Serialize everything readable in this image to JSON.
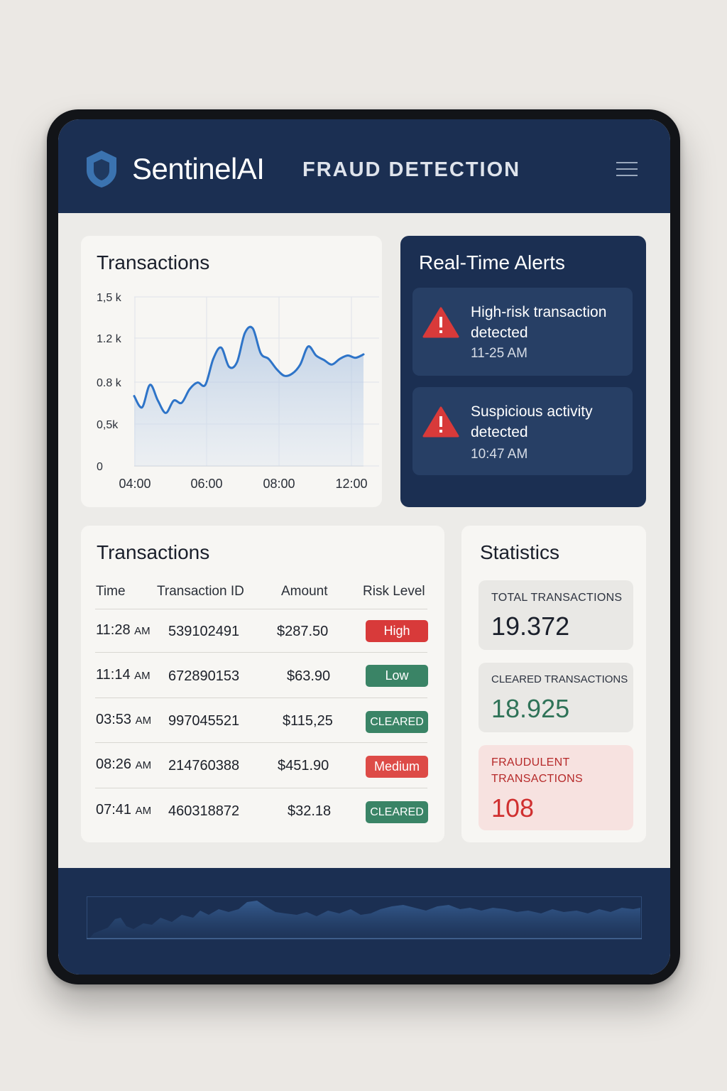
{
  "header": {
    "brand": "SentinelAI",
    "subtitle": "FRAUD DETECTION"
  },
  "chart_card": {
    "title": "Transactions"
  },
  "chart_data": {
    "type": "area",
    "title": "Transactions",
    "x_ticks": [
      "04:00",
      "06:00",
      "08:00",
      "12:00"
    ],
    "y_ticks": [
      "0",
      "0,5k",
      "0.8 k",
      "1.2 k",
      "1,5 k"
    ],
    "x": [
      "04:00",
      "04:15",
      "04:30",
      "04:45",
      "05:00",
      "05:15",
      "05:30",
      "05:45",
      "06:00",
      "06:15",
      "06:30",
      "06:45",
      "07:00",
      "07:15",
      "07:30",
      "07:45",
      "08:00",
      "08:15",
      "08:30",
      "08:45",
      "09:00",
      "09:15",
      "09:30",
      "09:45",
      "10:00",
      "10:15",
      "10:30",
      "11:00",
      "11:30",
      "12:00"
    ],
    "values": [
      0.62,
      0.52,
      0.72,
      0.58,
      0.47,
      0.58,
      0.56,
      0.68,
      0.74,
      0.72,
      0.95,
      1.05,
      0.88,
      0.92,
      1.18,
      1.22,
      1.0,
      0.95,
      0.86,
      0.8,
      0.82,
      0.9,
      1.06,
      0.98,
      0.94,
      0.9,
      0.95,
      0.98,
      0.96,
      0.99
    ],
    "ylim": [
      0,
      1.5
    ],
    "color": "#2e74c8"
  },
  "alerts": {
    "title": "Real-Time Alerts",
    "items": [
      {
        "text": "High-risk transaction detected",
        "time": "11-25 AM"
      },
      {
        "text": "Suspicious activity detected",
        "time": "10:47 AM"
      }
    ]
  },
  "transactions": {
    "title": "Transactions",
    "columns": [
      "Time",
      "Transaction ID",
      "Amount",
      "Risk Level"
    ],
    "rows": [
      {
        "time": "11:28",
        "ampm": "AM",
        "id": "539102491",
        "amount": "$287.50",
        "risk": "High",
        "color": "#d83a3a"
      },
      {
        "time": "11:14",
        "ampm": "AM",
        "id": "672890153",
        "amount": "$63.90",
        "risk": "Low",
        "color": "#3a8466"
      },
      {
        "time": "03:53",
        "ampm": "AM",
        "id": "997045521",
        "amount": "$115,25",
        "risk": "CLEARED",
        "color": "#3a8466"
      },
      {
        "time": "08:26",
        "ampm": "AM",
        "id": "214760388",
        "amount": "$451.90",
        "risk": "Medium",
        "color": "#dd4b47"
      },
      {
        "time": "07:41",
        "ampm": "AM",
        "id": "460318872",
        "amount": "$32.18",
        "risk": "CLEARED",
        "color": "#3a8466"
      }
    ]
  },
  "statistics": {
    "title": "Statistics",
    "total_label": "TOTAL TRANSACTIONS",
    "total_value": "19.372",
    "cleared_label": "CLEARED TRANSACTIONS",
    "cleared_value": "18.925",
    "fraud_label_1": "FRAUDULENT",
    "fraud_label_2": "TRANSACTIONS",
    "fraud_value": "108"
  },
  "colors": {
    "navy": "#1b2f52",
    "alert_red": "#d83a3a",
    "cleared_green": "#3a8466",
    "fraud_bg": "#f7e2e0"
  }
}
